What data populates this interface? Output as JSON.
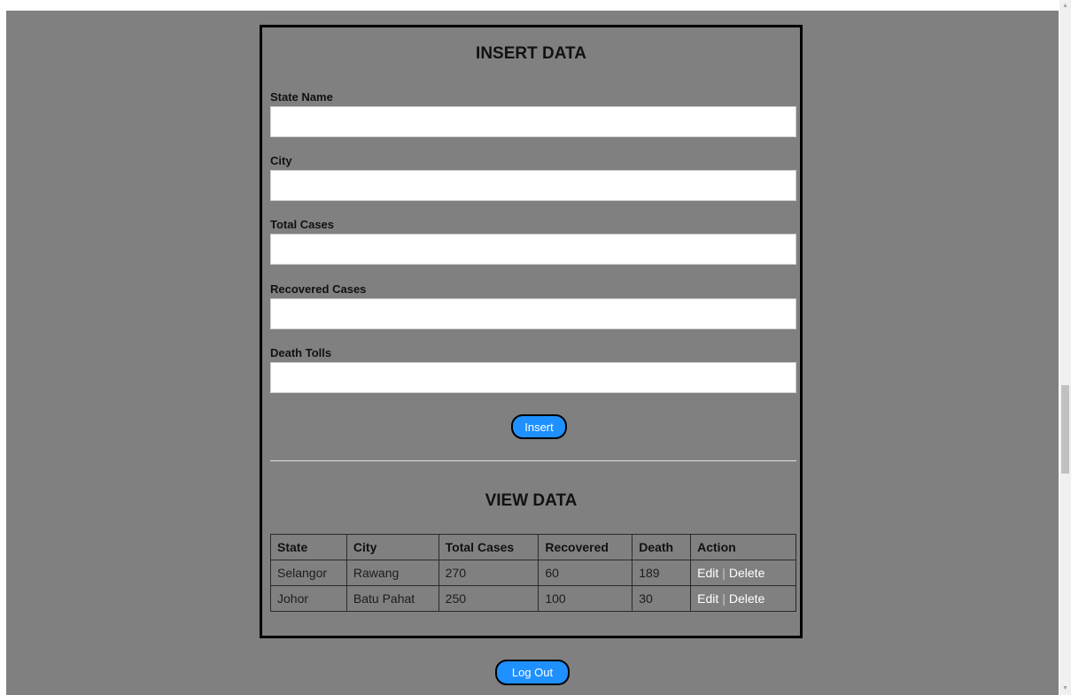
{
  "insert_section": {
    "title": "INSERT DATA",
    "fields": [
      {
        "label": "State Name",
        "value": ""
      },
      {
        "label": "City",
        "value": ""
      },
      {
        "label": "Total Cases",
        "value": ""
      },
      {
        "label": "Recovered Cases",
        "value": ""
      },
      {
        "label": "Death Tolls",
        "value": ""
      }
    ],
    "insert_label": "Insert"
  },
  "view_section": {
    "title": "VIEW DATA",
    "columns": [
      "State",
      "City",
      "Total Cases",
      "Recovered",
      "Death",
      "Action"
    ],
    "rows": [
      {
        "state": "Selangor",
        "city": "Rawang",
        "total": "270",
        "recovered": "60",
        "death": "189",
        "edit": "Edit",
        "sep": "|",
        "delete": "Delete"
      },
      {
        "state": "Johor",
        "city": "Batu Pahat",
        "total": "250",
        "recovered": "100",
        "death": "30",
        "edit": "Edit",
        "sep": "|",
        "delete": "Delete"
      }
    ]
  },
  "logout_label": "Log Out",
  "colors": {
    "page_background": "#808080",
    "button_blue": "#1e90ff"
  },
  "icons": {
    "scroll_up": "scroll-up-arrow-icon",
    "scroll_down": "scroll-down-arrow-icon"
  }
}
